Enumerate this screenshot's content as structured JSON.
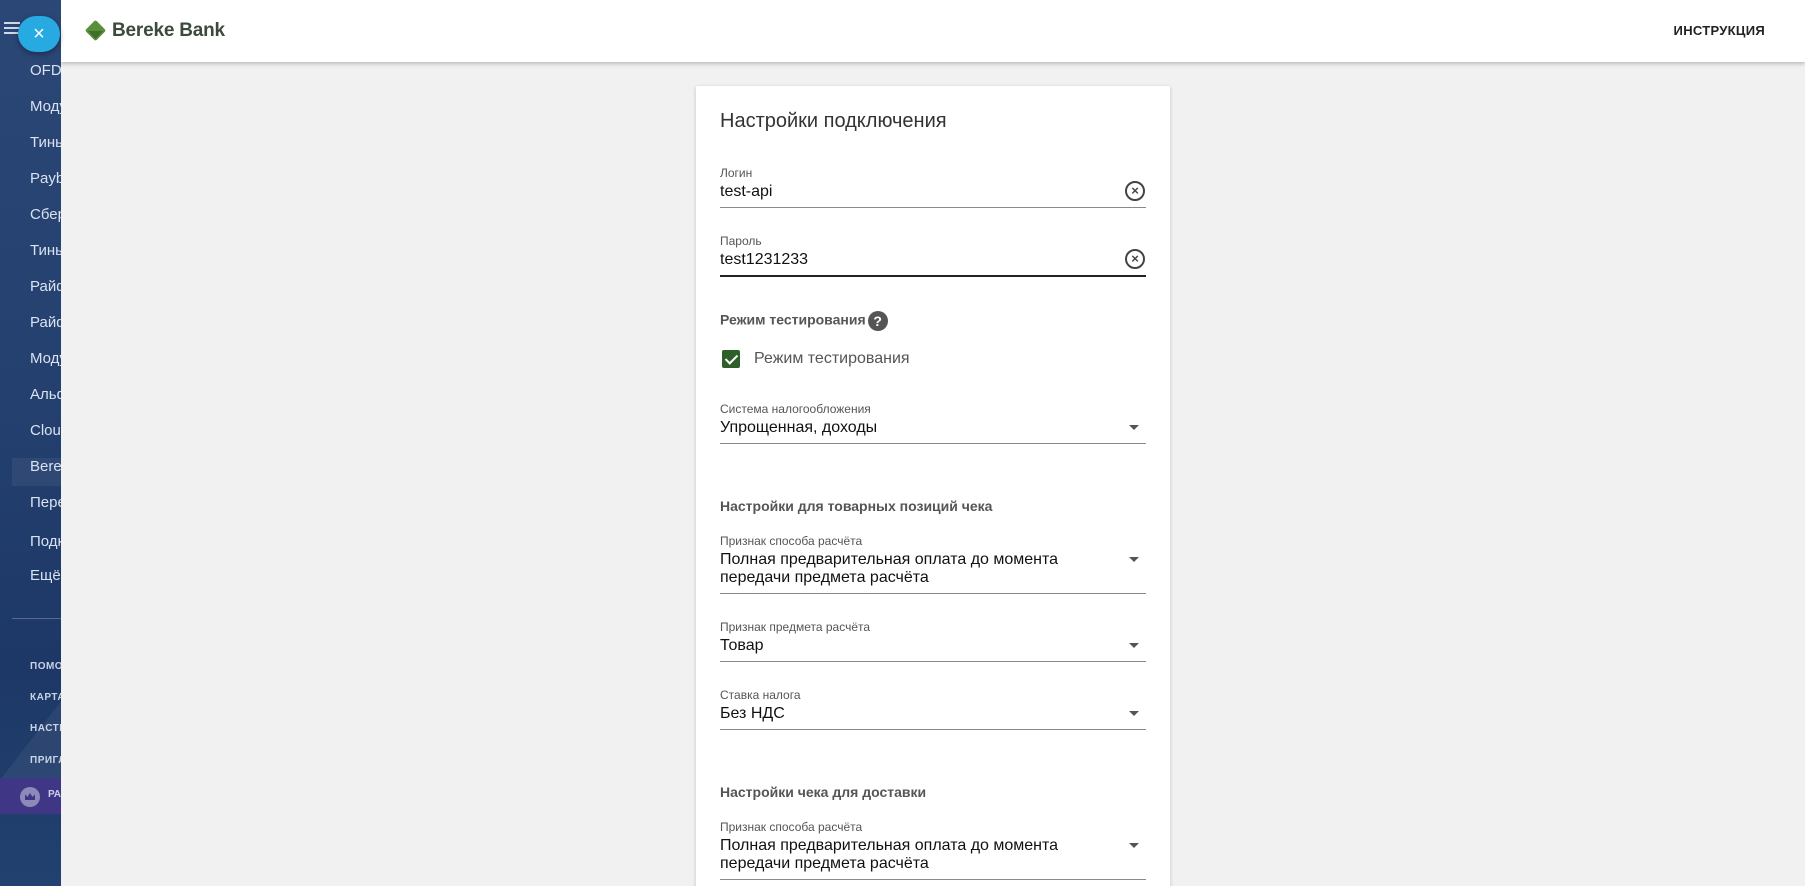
{
  "sidebar": {
    "items": [
      {
        "label": "OFD"
      },
      {
        "label": "Модульбанк"
      },
      {
        "label": "Тинькофф"
      },
      {
        "label": "Paybox"
      },
      {
        "label": "Сбербанк"
      },
      {
        "label": "Тинькофф"
      },
      {
        "label": "Райффайзен"
      },
      {
        "label": "Райффайзен"
      },
      {
        "label": "Модульбанк"
      },
      {
        "label": "Альфа"
      },
      {
        "label": "Cloud"
      },
      {
        "label": "Bereke"
      },
      {
        "label": "Перейти"
      }
    ],
    "extra_items": [
      {
        "label": "Подключить"
      },
      {
        "label": "Ещё"
      }
    ],
    "bottom_links": [
      {
        "label": "ПОМОЩЬ"
      },
      {
        "label": "КАРТА"
      },
      {
        "label": "НАСТРОЙКИ"
      },
      {
        "label": "ПРИГЛАСИТЬ"
      }
    ],
    "premium_label": "РА"
  },
  "close_button": {
    "symbol": "×"
  },
  "topbar": {
    "logo_text": "Bereke Bank",
    "instruction_label": "ИНСТРУКЦИЯ"
  },
  "card": {
    "title": "Настройки подключения",
    "login": {
      "label": "Логин",
      "value": "test-api"
    },
    "password": {
      "label": "Пароль",
      "value": "test1231233"
    },
    "test_mode": {
      "section_label": "Режим тестирования",
      "help_symbol": "?",
      "checkbox_label": "Режим тестирования",
      "checked": true
    },
    "tax_system": {
      "label": "Система налогообложения",
      "value": "Упрощенная, доходы"
    },
    "item_settings": {
      "section_label": "Настройки для товарных позиций чека",
      "payment_method": {
        "label": "Признак способа расчёта",
        "value_line1": "Полная предварительная оплата до момента",
        "value_line2": "передачи предмета расчёта"
      },
      "payment_subject": {
        "label": "Признак предмета расчёта",
        "value": "Товар"
      },
      "tax_rate": {
        "label": "Ставка налога",
        "value": "Без НДС"
      }
    },
    "delivery_settings": {
      "section_label": "Настройки чека для доставки",
      "payment_method": {
        "label": "Признак способа расчёта",
        "value_line1": "Полная предварительная оплата до момента",
        "value_line2": "передачи предмета расчёта"
      }
    }
  },
  "colors": {
    "sidebar_bg": "#24406e",
    "fab": "#27a9e1",
    "checkbox": "#2e5f2a",
    "brand_green": "#5b8e3b",
    "premium": "#3f3785"
  }
}
